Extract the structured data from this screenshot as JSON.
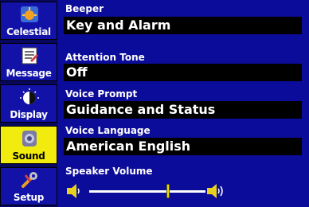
{
  "sidebar": {
    "tabs": [
      {
        "label": "Celestial",
        "icon": "celestial-icon",
        "selected": false
      },
      {
        "label": "Message",
        "icon": "message-icon",
        "selected": false
      },
      {
        "label": "Display",
        "icon": "display-icon",
        "selected": false
      },
      {
        "label": "Sound",
        "icon": "sound-icon",
        "selected": true
      },
      {
        "label": "Setup",
        "icon": "setup-icon",
        "selected": false
      }
    ]
  },
  "settings": {
    "beeper": {
      "label": "Beeper",
      "value": "Key and Alarm"
    },
    "attention_tone": {
      "label": "Attention Tone",
      "value": "Off"
    },
    "voice_prompt": {
      "label": "Voice Prompt",
      "value": "Guidance and Status"
    },
    "voice_language": {
      "label": "Voice Language",
      "value": "American English"
    },
    "speaker_volume": {
      "label": "Speaker Volume",
      "level_fraction": 0.68
    }
  },
  "colors": {
    "background": "#0c0c9a",
    "selected_tab": "#f2ec0e",
    "field": "#000000",
    "text": "#ffffff"
  }
}
